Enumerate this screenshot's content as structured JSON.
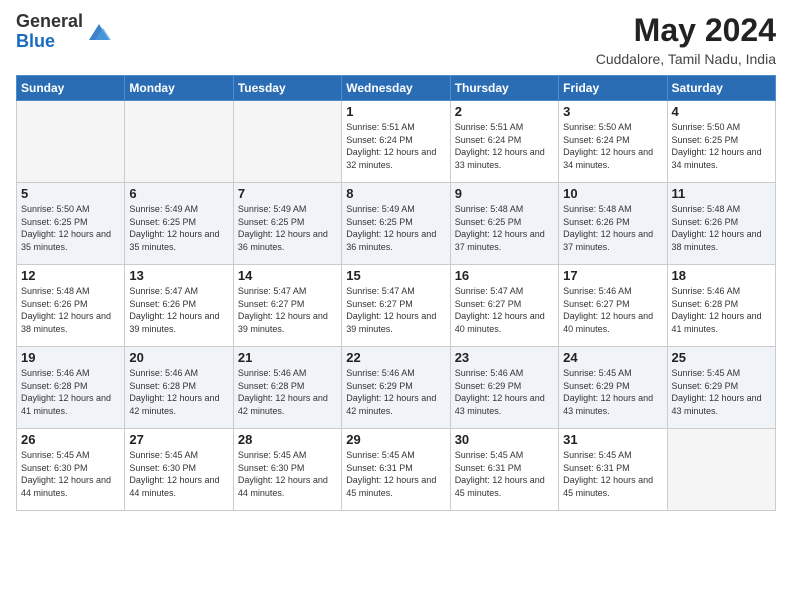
{
  "header": {
    "logo_general": "General",
    "logo_blue": "Blue",
    "month_title": "May 2024",
    "location": "Cuddalore, Tamil Nadu, India"
  },
  "weekdays": [
    "Sunday",
    "Monday",
    "Tuesday",
    "Wednesday",
    "Thursday",
    "Friday",
    "Saturday"
  ],
  "weeks": [
    [
      {
        "day": "",
        "sunrise": "",
        "sunset": "",
        "daylight": ""
      },
      {
        "day": "",
        "sunrise": "",
        "sunset": "",
        "daylight": ""
      },
      {
        "day": "",
        "sunrise": "",
        "sunset": "",
        "daylight": ""
      },
      {
        "day": "1",
        "sunrise": "Sunrise: 5:51 AM",
        "sunset": "Sunset: 6:24 PM",
        "daylight": "Daylight: 12 hours and 32 minutes."
      },
      {
        "day": "2",
        "sunrise": "Sunrise: 5:51 AM",
        "sunset": "Sunset: 6:24 PM",
        "daylight": "Daylight: 12 hours and 33 minutes."
      },
      {
        "day": "3",
        "sunrise": "Sunrise: 5:50 AM",
        "sunset": "Sunset: 6:24 PM",
        "daylight": "Daylight: 12 hours and 34 minutes."
      },
      {
        "day": "4",
        "sunrise": "Sunrise: 5:50 AM",
        "sunset": "Sunset: 6:25 PM",
        "daylight": "Daylight: 12 hours and 34 minutes."
      }
    ],
    [
      {
        "day": "5",
        "sunrise": "Sunrise: 5:50 AM",
        "sunset": "Sunset: 6:25 PM",
        "daylight": "Daylight: 12 hours and 35 minutes."
      },
      {
        "day": "6",
        "sunrise": "Sunrise: 5:49 AM",
        "sunset": "Sunset: 6:25 PM",
        "daylight": "Daylight: 12 hours and 35 minutes."
      },
      {
        "day": "7",
        "sunrise": "Sunrise: 5:49 AM",
        "sunset": "Sunset: 6:25 PM",
        "daylight": "Daylight: 12 hours and 36 minutes."
      },
      {
        "day": "8",
        "sunrise": "Sunrise: 5:49 AM",
        "sunset": "Sunset: 6:25 PM",
        "daylight": "Daylight: 12 hours and 36 minutes."
      },
      {
        "day": "9",
        "sunrise": "Sunrise: 5:48 AM",
        "sunset": "Sunset: 6:25 PM",
        "daylight": "Daylight: 12 hours and 37 minutes."
      },
      {
        "day": "10",
        "sunrise": "Sunrise: 5:48 AM",
        "sunset": "Sunset: 6:26 PM",
        "daylight": "Daylight: 12 hours and 37 minutes."
      },
      {
        "day": "11",
        "sunrise": "Sunrise: 5:48 AM",
        "sunset": "Sunset: 6:26 PM",
        "daylight": "Daylight: 12 hours and 38 minutes."
      }
    ],
    [
      {
        "day": "12",
        "sunrise": "Sunrise: 5:48 AM",
        "sunset": "Sunset: 6:26 PM",
        "daylight": "Daylight: 12 hours and 38 minutes."
      },
      {
        "day": "13",
        "sunrise": "Sunrise: 5:47 AM",
        "sunset": "Sunset: 6:26 PM",
        "daylight": "Daylight: 12 hours and 39 minutes."
      },
      {
        "day": "14",
        "sunrise": "Sunrise: 5:47 AM",
        "sunset": "Sunset: 6:27 PM",
        "daylight": "Daylight: 12 hours and 39 minutes."
      },
      {
        "day": "15",
        "sunrise": "Sunrise: 5:47 AM",
        "sunset": "Sunset: 6:27 PM",
        "daylight": "Daylight: 12 hours and 39 minutes."
      },
      {
        "day": "16",
        "sunrise": "Sunrise: 5:47 AM",
        "sunset": "Sunset: 6:27 PM",
        "daylight": "Daylight: 12 hours and 40 minutes."
      },
      {
        "day": "17",
        "sunrise": "Sunrise: 5:46 AM",
        "sunset": "Sunset: 6:27 PM",
        "daylight": "Daylight: 12 hours and 40 minutes."
      },
      {
        "day": "18",
        "sunrise": "Sunrise: 5:46 AM",
        "sunset": "Sunset: 6:28 PM",
        "daylight": "Daylight: 12 hours and 41 minutes."
      }
    ],
    [
      {
        "day": "19",
        "sunrise": "Sunrise: 5:46 AM",
        "sunset": "Sunset: 6:28 PM",
        "daylight": "Daylight: 12 hours and 41 minutes."
      },
      {
        "day": "20",
        "sunrise": "Sunrise: 5:46 AM",
        "sunset": "Sunset: 6:28 PM",
        "daylight": "Daylight: 12 hours and 42 minutes."
      },
      {
        "day": "21",
        "sunrise": "Sunrise: 5:46 AM",
        "sunset": "Sunset: 6:28 PM",
        "daylight": "Daylight: 12 hours and 42 minutes."
      },
      {
        "day": "22",
        "sunrise": "Sunrise: 5:46 AM",
        "sunset": "Sunset: 6:29 PM",
        "daylight": "Daylight: 12 hours and 42 minutes."
      },
      {
        "day": "23",
        "sunrise": "Sunrise: 5:46 AM",
        "sunset": "Sunset: 6:29 PM",
        "daylight": "Daylight: 12 hours and 43 minutes."
      },
      {
        "day": "24",
        "sunrise": "Sunrise: 5:45 AM",
        "sunset": "Sunset: 6:29 PM",
        "daylight": "Daylight: 12 hours and 43 minutes."
      },
      {
        "day": "25",
        "sunrise": "Sunrise: 5:45 AM",
        "sunset": "Sunset: 6:29 PM",
        "daylight": "Daylight: 12 hours and 43 minutes."
      }
    ],
    [
      {
        "day": "26",
        "sunrise": "Sunrise: 5:45 AM",
        "sunset": "Sunset: 6:30 PM",
        "daylight": "Daylight: 12 hours and 44 minutes."
      },
      {
        "day": "27",
        "sunrise": "Sunrise: 5:45 AM",
        "sunset": "Sunset: 6:30 PM",
        "daylight": "Daylight: 12 hours and 44 minutes."
      },
      {
        "day": "28",
        "sunrise": "Sunrise: 5:45 AM",
        "sunset": "Sunset: 6:30 PM",
        "daylight": "Daylight: 12 hours and 44 minutes."
      },
      {
        "day": "29",
        "sunrise": "Sunrise: 5:45 AM",
        "sunset": "Sunset: 6:31 PM",
        "daylight": "Daylight: 12 hours and 45 minutes."
      },
      {
        "day": "30",
        "sunrise": "Sunrise: 5:45 AM",
        "sunset": "Sunset: 6:31 PM",
        "daylight": "Daylight: 12 hours and 45 minutes."
      },
      {
        "day": "31",
        "sunrise": "Sunrise: 5:45 AM",
        "sunset": "Sunset: 6:31 PM",
        "daylight": "Daylight: 12 hours and 45 minutes."
      },
      {
        "day": "",
        "sunrise": "",
        "sunset": "",
        "daylight": ""
      }
    ]
  ]
}
